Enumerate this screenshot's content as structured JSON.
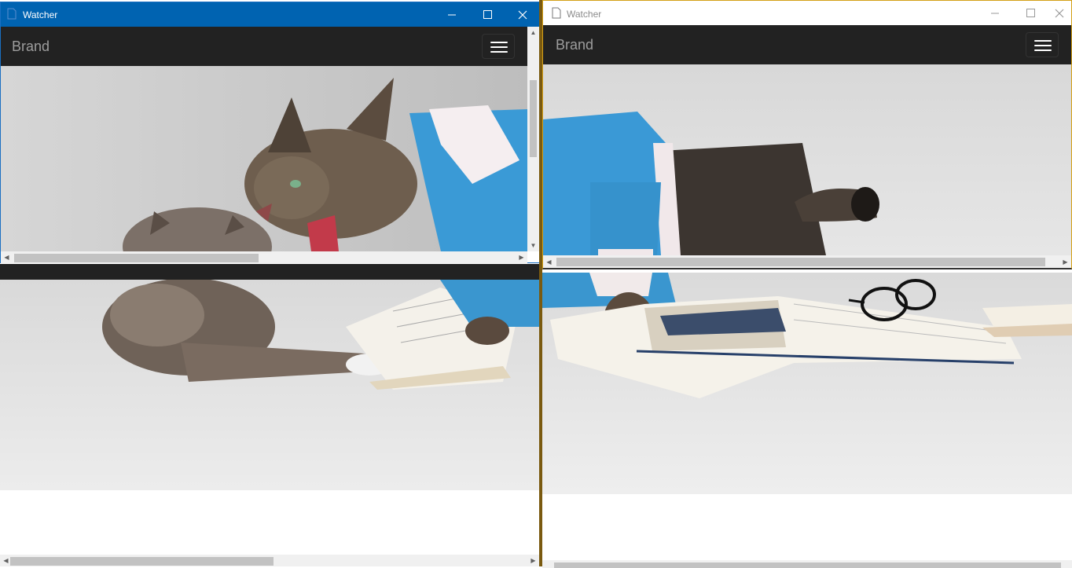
{
  "left_window": {
    "title": "Watcher",
    "brand": "Brand",
    "titlebar_color": "#0063b1",
    "icons": {
      "app": "document-icon",
      "minimize": "minimize-icon",
      "maximize": "maximize-icon",
      "close": "close-icon",
      "menu": "hamburger-menu-icon"
    }
  },
  "right_window": {
    "title": "Watcher",
    "brand": "Brand",
    "border_color": "#d4a017",
    "icons": {
      "app": "document-icon",
      "minimize": "minimize-icon",
      "maximize": "maximize-icon",
      "close": "close-icon",
      "menu": "hamburger-menu-icon"
    }
  },
  "images": {
    "left_popup": "cat-hissing-at-kitten-photo",
    "left_background": "kitten-with-book-photo",
    "right_popup": "cat-in-blue-sweater-photo",
    "right_background": "cat-with-books-and-glasses-photo"
  },
  "colors": {
    "navbar": "#222222",
    "brand_text": "#9d9d9d",
    "scrollbar_track": "#f0f0f0",
    "scrollbar_thumb": "#c2c2c2"
  }
}
